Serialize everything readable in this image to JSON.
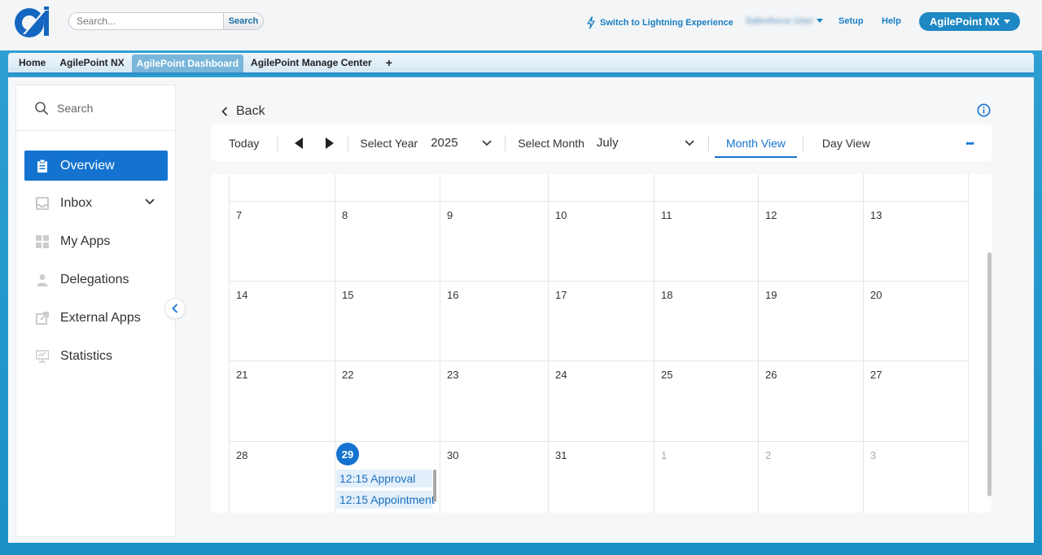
{
  "header": {
    "search_placeholder": "Search...",
    "search_button": "Search",
    "lightning_link": "Switch to Lightning Experience",
    "user_name": "Salesforce User",
    "setup": "Setup",
    "help": "Help",
    "app_switcher": "AgilePoint NX"
  },
  "tabs": [
    {
      "label": "Home"
    },
    {
      "label": "AgilePoint NX"
    },
    {
      "label": "AgilePoint Dashboard"
    },
    {
      "label": "AgilePoint Manage Center"
    }
  ],
  "tab_add": "+",
  "sidebar": {
    "search_placeholder": "Search",
    "items": [
      {
        "label": "Overview"
      },
      {
        "label": "Inbox"
      },
      {
        "label": "My Apps"
      },
      {
        "label": "Delegations"
      },
      {
        "label": "External Apps"
      },
      {
        "label": "Statistics"
      }
    ]
  },
  "main": {
    "back": "Back",
    "toolbar": {
      "today": "Today",
      "select_year_label": "Select Year",
      "year": "2025",
      "select_month_label": "Select Month",
      "month": "July",
      "month_view": "Month View",
      "day_view": "Day View",
      "more": "•••"
    }
  },
  "calendar": {
    "weeks": [
      [
        "7",
        "8",
        "9",
        "10",
        "11",
        "12",
        "13"
      ],
      [
        "14",
        "15",
        "16",
        "17",
        "18",
        "19",
        "20"
      ],
      [
        "21",
        "22",
        "23",
        "24",
        "25",
        "26",
        "27"
      ],
      [
        "28",
        "29",
        "30",
        "31",
        "1",
        "2",
        "3"
      ]
    ],
    "today": "29",
    "events": [
      {
        "label": "12:15 Approval"
      },
      {
        "label": "12:15 Appointment"
      }
    ]
  },
  "colors": {
    "accent": "#1473d0",
    "header_button": "#1e88c4",
    "tab_active": "#7ab6da"
  }
}
